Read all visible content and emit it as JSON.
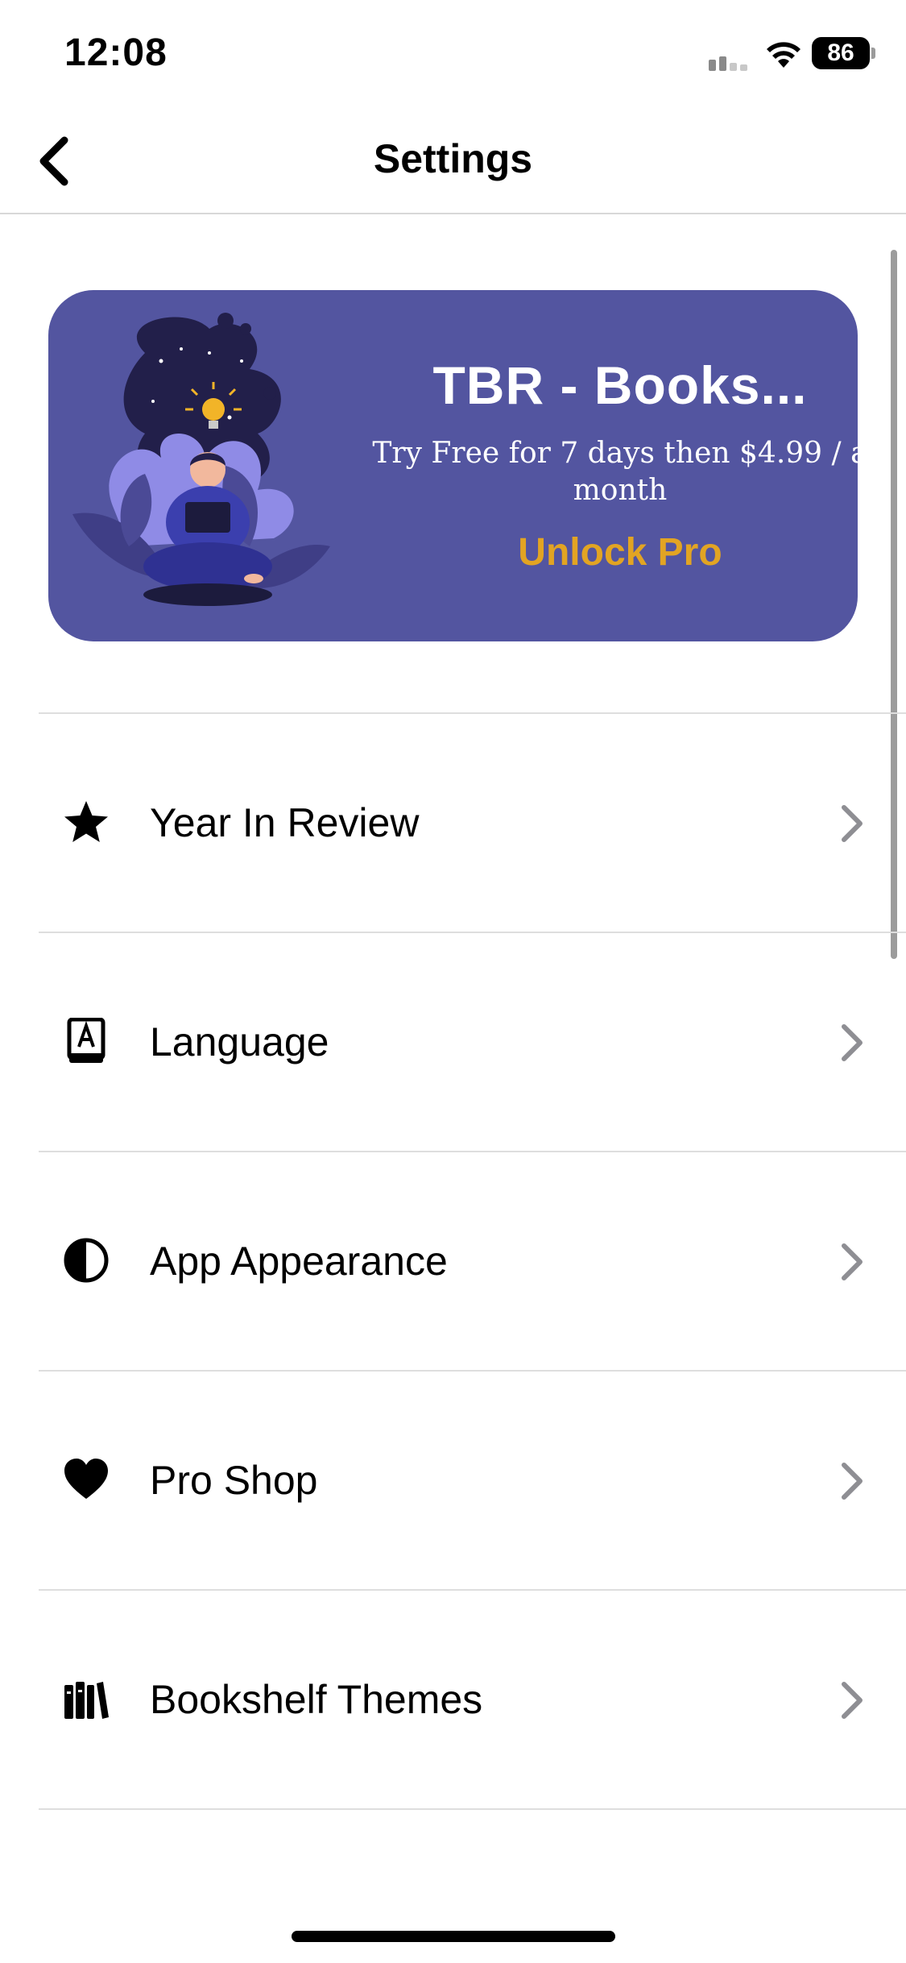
{
  "status_bar": {
    "time": "12:08",
    "battery": "86"
  },
  "nav": {
    "title": "Settings",
    "back_icon": "chevron-left-icon"
  },
  "promo": {
    "title": "TBR - Books...",
    "subtitle": "Try Free for 7 days then $4.99 / a month",
    "cta": "Unlock Pro",
    "colors": {
      "background": "#5355a0",
      "cta": "#e2a423",
      "text": "#ffffff"
    }
  },
  "settings": {
    "items": [
      {
        "label": "Year In Review",
        "icon": "star-icon"
      },
      {
        "label": "Language",
        "icon": "dictionary-icon"
      },
      {
        "label": "App Appearance",
        "icon": "half-circle-icon"
      },
      {
        "label": "Pro Shop",
        "icon": "heart-icon"
      },
      {
        "label": "Bookshelf Themes",
        "icon": "books-icon"
      }
    ]
  }
}
